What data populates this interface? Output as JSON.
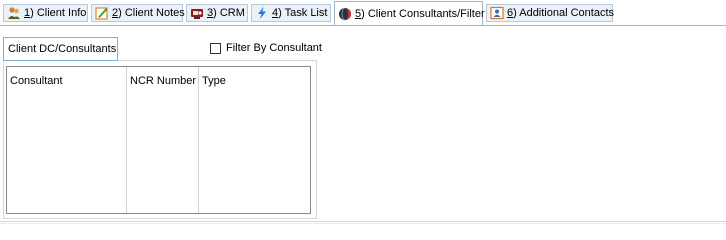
{
  "tabs": [
    {
      "label_num": "1",
      "label_text": ") Client Info",
      "icon": "people-icon",
      "active": false
    },
    {
      "label_num": "2",
      "label_text": ") Client Notes",
      "icon": "notepad-icon",
      "active": false
    },
    {
      "label_num": "3",
      "label_text": ") CRM",
      "icon": "crm-contacts-icon",
      "active": false
    },
    {
      "label_num": "4",
      "label_text": ") Task List",
      "icon": "lightning-icon",
      "active": false
    },
    {
      "label_num": "5",
      "label_text": ") Client Consultants/Filter",
      "icon": "filter-globe-icon",
      "active": true
    },
    {
      "label_num": "6",
      "label_text": ") Additional Contacts",
      "icon": "contact-card-icon",
      "active": false
    }
  ],
  "subtab": {
    "label": "Client DC/Consultants"
  },
  "filter": {
    "label": "Filter By Consultant",
    "checked": false
  },
  "grid": {
    "columns": [
      "Consultant",
      "NCR Number",
      "Type"
    ],
    "rows": []
  },
  "colors": {
    "tab_border": "#b9c9d9",
    "tab_bg": "#eaf1f8",
    "subtab_border": "#7fb0d8"
  }
}
